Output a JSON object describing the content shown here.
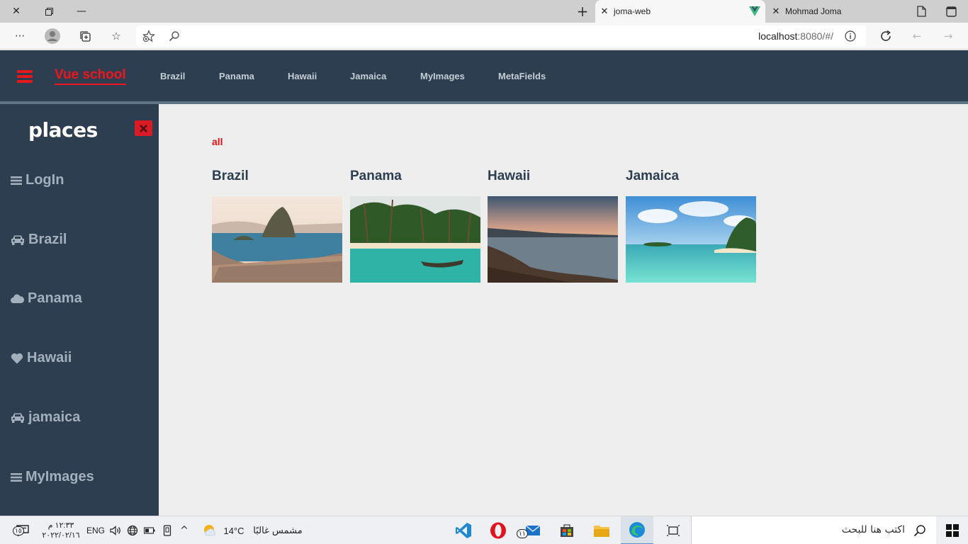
{
  "browser": {
    "tabs": [
      {
        "title": "joma-web",
        "active": true
      },
      {
        "title": "Mohmad Joma",
        "active": false
      }
    ],
    "url_host": "localhost",
    "url_rest": ":8080/#/"
  },
  "header": {
    "brand": "Vue school",
    "nav": [
      "Brazil",
      "Panama",
      "Hawaii",
      "Jamaica",
      "MyImages",
      "MetaFields"
    ],
    "accent_color": "#f0141c",
    "bg_color": "#2c3e50"
  },
  "sidebar": {
    "title": "places",
    "items": [
      {
        "label": "LogIn",
        "icon": "bars-icon"
      },
      {
        "label": "Brazil",
        "icon": "car-icon"
      },
      {
        "label": "Panama",
        "icon": "cloud-icon"
      },
      {
        "label": "Hawaii",
        "icon": "heart-icon"
      },
      {
        "label": "jamaica",
        "icon": "car-icon"
      },
      {
        "label": "MyImages",
        "icon": "bars-icon"
      }
    ]
  },
  "main": {
    "filter_label": "all",
    "cards": [
      {
        "title": "Brazil"
      },
      {
        "title": "Panama"
      },
      {
        "title": "Hawaii"
      },
      {
        "title": "Jamaica"
      }
    ]
  },
  "taskbar": {
    "time": "١٢:٣٣ م",
    "date": "٢٠٢٢/٠٢/١٦",
    "lang": "ENG",
    "weather_temp": "14°C",
    "weather_text": "مشمس غالبًا",
    "search_placeholder": "اكتب هنا للبحث",
    "notif_count": "١٥",
    "mail_count": "١١"
  }
}
